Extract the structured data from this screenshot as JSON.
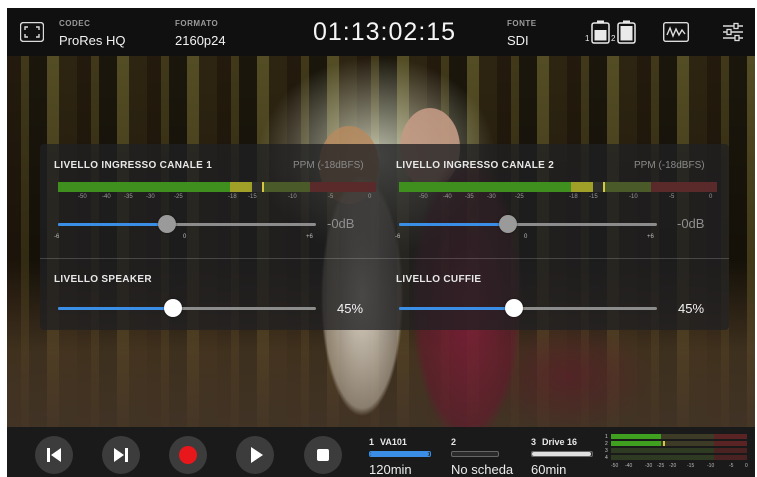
{
  "topbar": {
    "codec_label": "CODEC",
    "codec_value": "ProRes HQ",
    "format_label": "FORMATO",
    "format_value": "2160p24",
    "timecode": "01:13:02:15",
    "source_label": "FONTE",
    "source_value": "SDI",
    "battery1_index": "1",
    "battery2_index": "2",
    "icons": [
      "fullscreen-icon",
      "battery-icon",
      "battery-icon",
      "waveform-icon",
      "settings-sliders-icon"
    ]
  },
  "audio_panel": {
    "channel1": {
      "title": "LIVELLO INGRESSO CANALE 1",
      "mode": "PPM (-18dBFS)",
      "scale": [
        "-50",
        "-40",
        "-35",
        "-30",
        "-25",
        "-18",
        "-15",
        "-10",
        "-5",
        "0"
      ],
      "gain_value": "-0dB",
      "gain_min": "-6",
      "gain_mid": "0",
      "gain_max": "+6",
      "gain_level": 0.5
    },
    "channel2": {
      "title": "LIVELLO INGRESSO CANALE 2",
      "mode": "PPM (-18dBFS)",
      "scale": [
        "-50",
        "-40",
        "-35",
        "-30",
        "-25",
        "-18",
        "-15",
        "-10",
        "-5",
        "0"
      ],
      "gain_value": "-0dB",
      "gain_min": "-6",
      "gain_mid": "0",
      "gain_max": "+6",
      "gain_level": 0.5
    },
    "speaker": {
      "title": "LIVELLO SPEAKER",
      "value": "45%",
      "level": 0.45
    },
    "headphones": {
      "title": "LIVELLO CUFFIE",
      "value": "45%",
      "level": 0.45
    }
  },
  "transport": {
    "buttons": [
      "skip-back-icon",
      "skip-forward-icon",
      "record-icon",
      "play-icon",
      "stop-icon"
    ]
  },
  "media": {
    "slots": [
      {
        "index": "1",
        "name": "VA101",
        "remaining": "120min",
        "fill": 0.98,
        "color": "#3a8ee6"
      },
      {
        "index": "2",
        "name": "",
        "remaining": "No scheda",
        "fill": 0.0,
        "color": "#555555"
      },
      {
        "index": "3",
        "name": "Drive 16",
        "remaining": "60min",
        "fill": 0.98,
        "color": "#e0e0e0"
      }
    ]
  },
  "mini_meter": {
    "channels": [
      "1",
      "2",
      "3",
      "4"
    ],
    "scale": [
      "-50",
      "-40",
      "-30",
      "-25",
      "-20",
      "-15",
      "-10",
      "-5",
      "0"
    ]
  },
  "colors": {
    "accent": "#3a8ee6",
    "record": "#e8171b",
    "meter_green": "#3f8f1f",
    "meter_yellow": "#a0a028"
  }
}
